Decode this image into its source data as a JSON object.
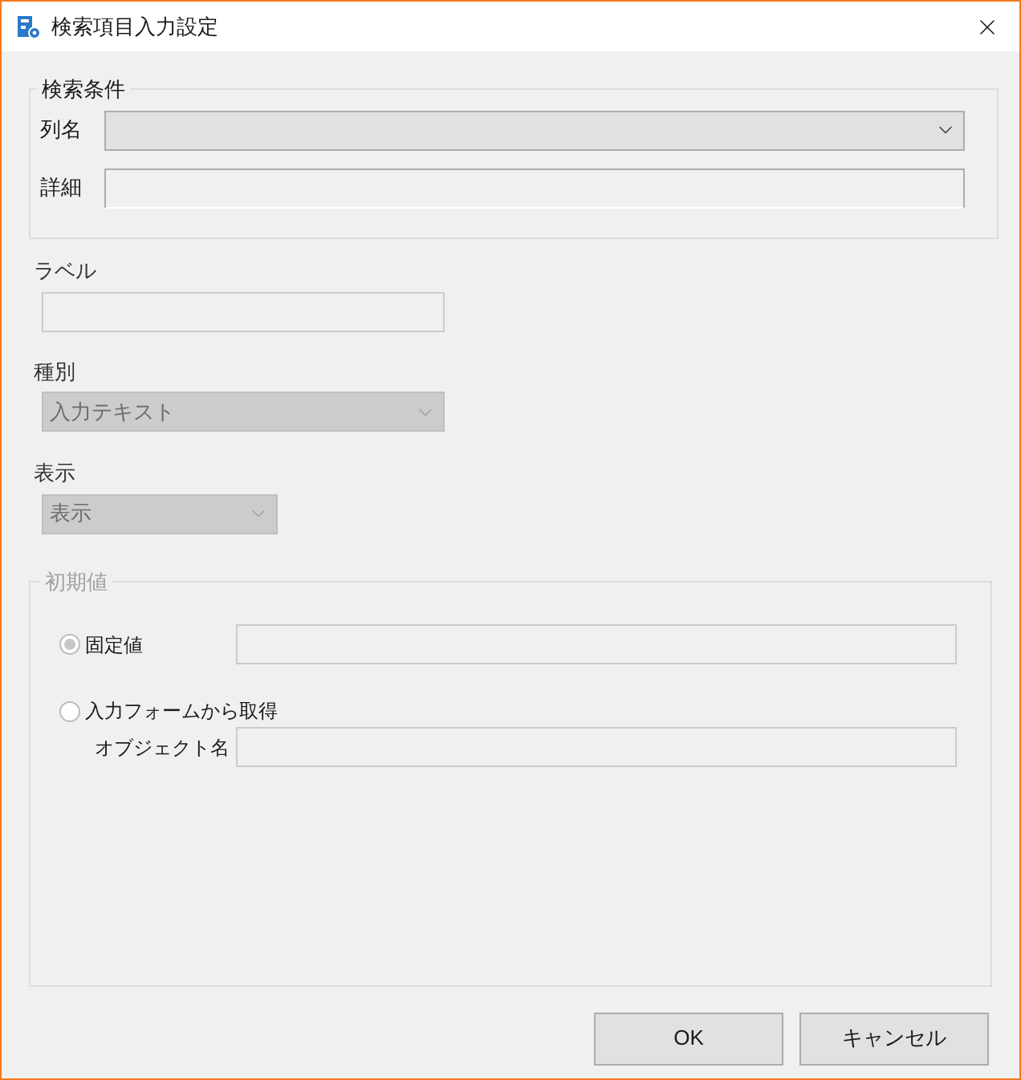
{
  "window": {
    "title": "検索項目入力設定"
  },
  "search_condition": {
    "title": "検索条件",
    "column_name": {
      "label": "列名",
      "disabled": false
    },
    "detail": {
      "label": "詳細",
      "disabled": false
    }
  },
  "label_field": {
    "label": "ラベル",
    "disabled": true
  },
  "type_field": {
    "label": "種別",
    "value": "入力テキスト",
    "disabled": true
  },
  "display_field": {
    "label": "表示",
    "value": "表示",
    "disabled": true
  },
  "initial_value": {
    "title": "初期値",
    "disabled": true,
    "options": [
      {
        "label": "固定値",
        "selected": true
      },
      {
        "label": "入力フォームから取得",
        "selected": false
      }
    ],
    "object_name": {
      "label": "オブジェクト名"
    }
  },
  "buttons": [
    "OK",
    "キャンセル"
  ]
}
